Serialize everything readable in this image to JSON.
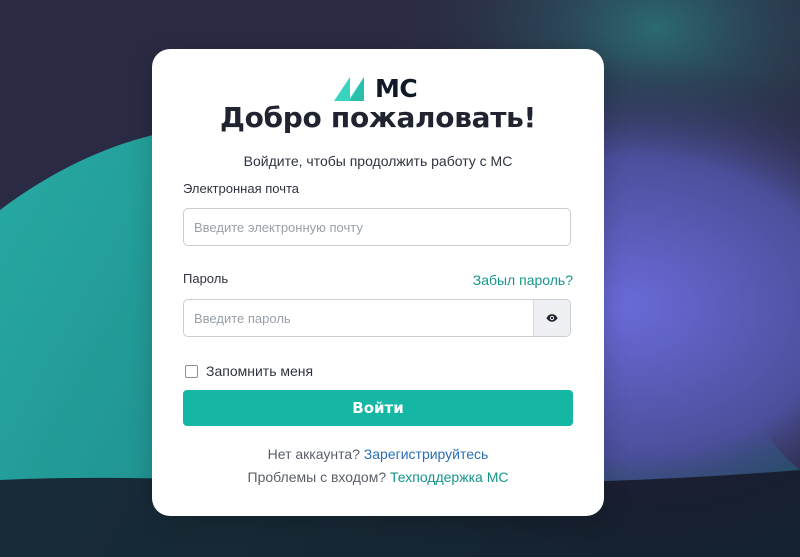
{
  "brand": {
    "logo_text": "МС",
    "accent_color": "#16b6a5",
    "logo_color": "#38d4c0"
  },
  "login": {
    "title": "Добро пожаловать!",
    "subtitle": "Войдите, чтобы продолжить работу с МС",
    "email_label": "Электронная почта",
    "email_placeholder": "Введите электронную почту",
    "email_value": "",
    "password_label": "Пароль",
    "forgot_link": "Забыл пароль?",
    "password_placeholder": "Введите пароль",
    "password_value": "",
    "toggle_icon": "eye-icon",
    "remember_label": "Запомнить меня",
    "remember_checked": false,
    "submit_label": "Войти"
  },
  "footer": {
    "no_account_text": "Нет аккаунта?",
    "register_link": "Зарегистрируйтесь",
    "problems_text": "Проблемы с входом?",
    "support_link": "Техподдержка МС"
  }
}
